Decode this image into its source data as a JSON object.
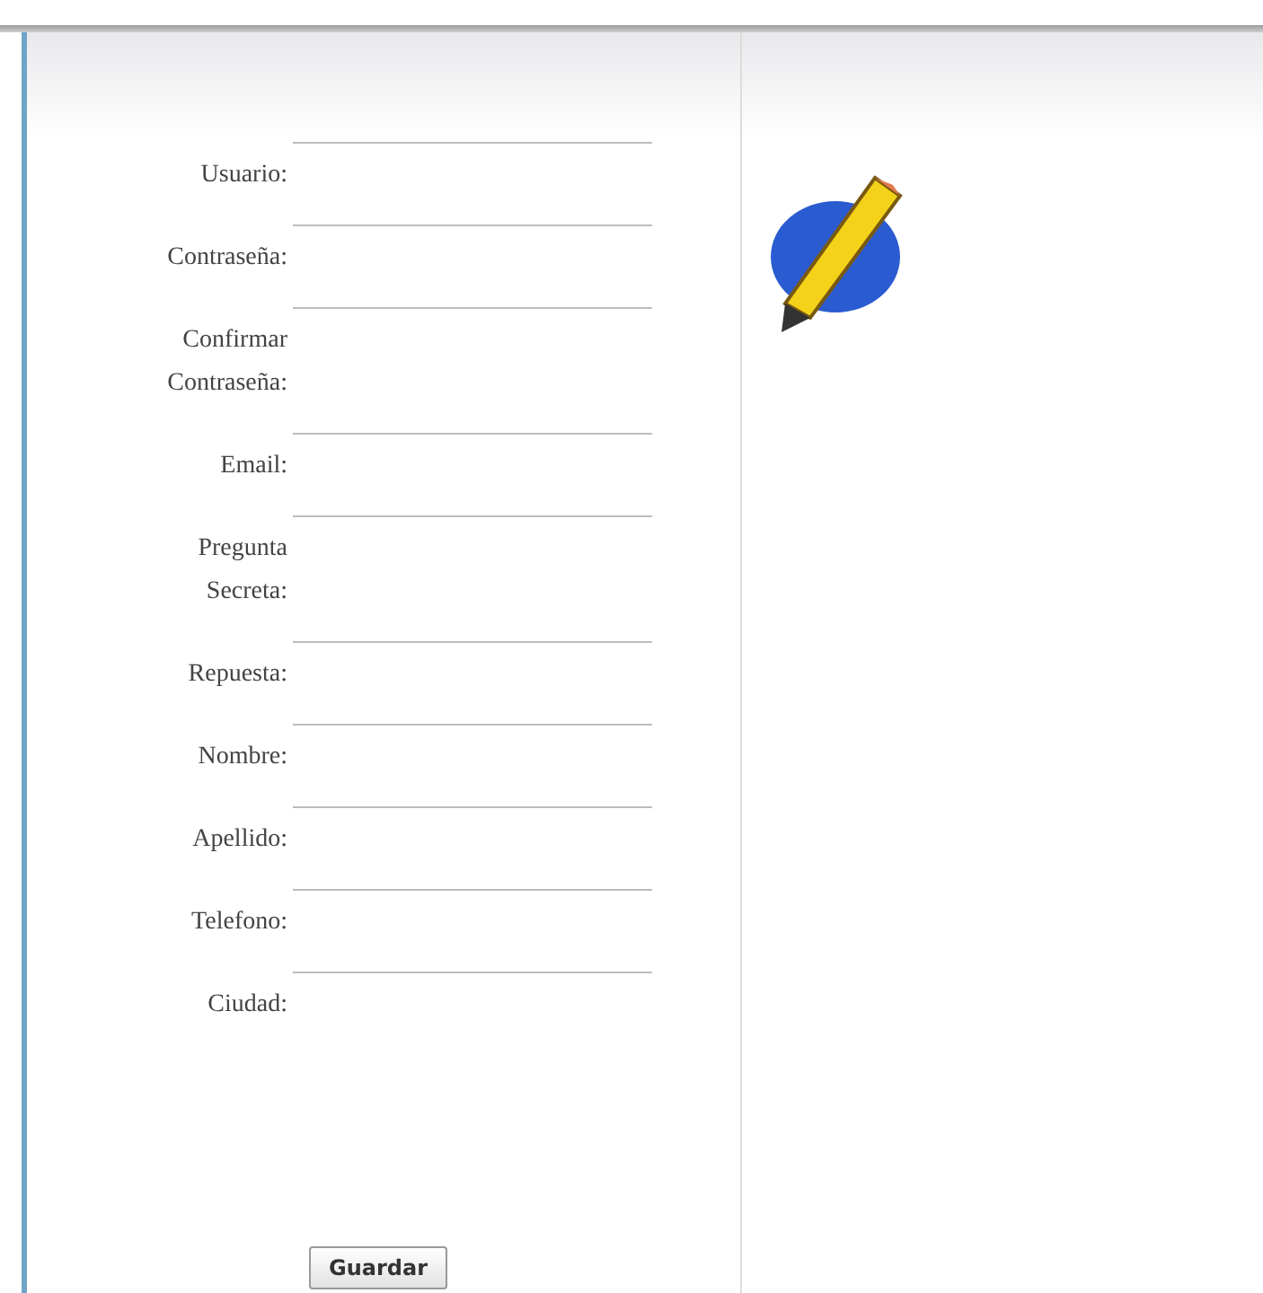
{
  "form": {
    "fields": [
      {
        "label": "Usuario:"
      },
      {
        "label": "Contraseña:"
      },
      {
        "label": "Confirmar Contraseña:"
      },
      {
        "label": "Email:"
      },
      {
        "label": "Pregunta Secreta:"
      },
      {
        "label": "Repuesta:"
      },
      {
        "label": "Nombre:"
      },
      {
        "label": "Apellido:"
      },
      {
        "label": "Telefono:"
      },
      {
        "label": "Ciudad:"
      }
    ],
    "submit": "Guardar"
  }
}
